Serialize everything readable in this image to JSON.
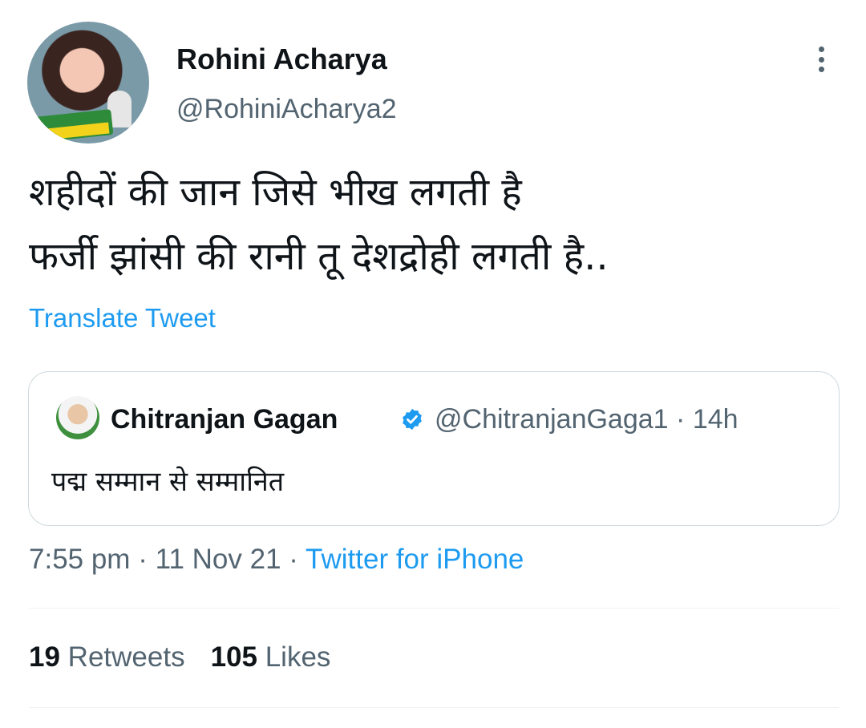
{
  "author": {
    "display_name": "Rohini Acharya",
    "handle": "@RohiniAcharya2",
    "avatar_icon": "profile-photo"
  },
  "tweet": {
    "lines": [
      "शहीदों की जान जिसे भीख लगती है",
      "फर्जी झांसी की रानी तू देशद्रोही लगती है.."
    ],
    "translate_label": "Translate Tweet"
  },
  "quoted": {
    "display_name": "Chitranjan Gagan",
    "handle": "@ChitranjanGaga1",
    "separator": "·",
    "age": "14h",
    "text": "पद्म सम्मान से सम्मानित",
    "verified_icon": "verified-badge",
    "verified_color": "#1d9bf0"
  },
  "meta": {
    "time": "7:55 pm",
    "date": "11 Nov 21",
    "separator": "·",
    "source": "Twitter for iPhone"
  },
  "stats": {
    "retweets_count": "19",
    "retweets_label": "Retweets",
    "likes_count": "105",
    "likes_label": "Likes"
  },
  "colors": {
    "link": "#1d9bf0",
    "text": "#0f1419",
    "muted": "#536471",
    "border": "#cfd9de"
  }
}
